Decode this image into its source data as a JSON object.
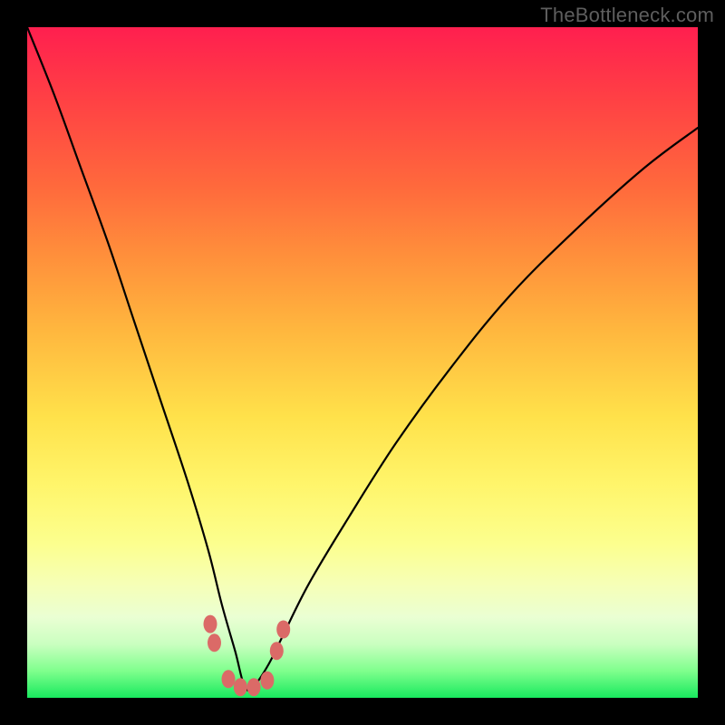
{
  "watermark": "TheBottleneck.com",
  "colors": {
    "frame": "#000000",
    "gradient_top": "#ff1f4f",
    "gradient_bottom": "#18e95e",
    "curve": "#000000",
    "marker": "#db6a67"
  },
  "chart_data": {
    "type": "line",
    "title": "",
    "xlabel": "",
    "ylabel": "",
    "xlim": [
      0,
      100
    ],
    "ylim": [
      0,
      100
    ],
    "grid": false,
    "legend": false,
    "note": "Single V-shaped bottleneck curve on red→green vertical gradient; minimum near x≈33. Axis is unlabeled; values estimated from pixel position (0 at bottom, 100 at top).",
    "series": [
      {
        "name": "bottleneck-curve",
        "x": [
          0,
          4,
          8,
          12,
          16,
          20,
          24,
          27,
          29,
          31,
          32.5,
          34,
          36,
          38,
          42,
          48,
          55,
          63,
          72,
          82,
          92,
          100
        ],
        "y": [
          100,
          90,
          79,
          68,
          56,
          44,
          32,
          22,
          14,
          7,
          1.5,
          2,
          5,
          9,
          17,
          27,
          38,
          49,
          60,
          70,
          79,
          85
        ]
      }
    ],
    "markers": {
      "name": "highlighted-points",
      "note": "Salmon blobs clustered near the curve minimum, on both descending and ascending branches near the floor.",
      "points": [
        {
          "x": 27.3,
          "y": 11.0
        },
        {
          "x": 27.9,
          "y": 8.2
        },
        {
          "x": 30.0,
          "y": 2.8
        },
        {
          "x": 31.8,
          "y": 1.6
        },
        {
          "x": 33.8,
          "y": 1.6
        },
        {
          "x": 35.8,
          "y": 2.6
        },
        {
          "x": 37.2,
          "y": 7.0
        },
        {
          "x": 38.2,
          "y": 10.2
        }
      ]
    }
  }
}
